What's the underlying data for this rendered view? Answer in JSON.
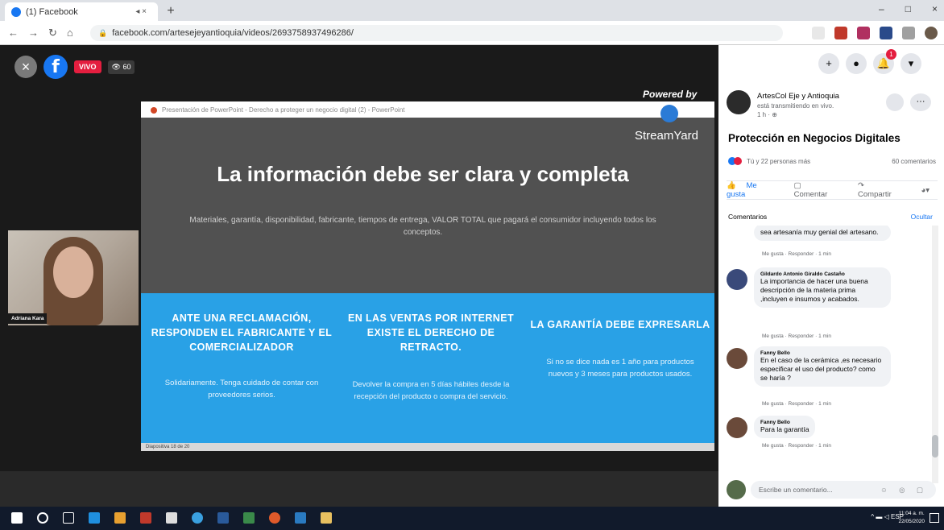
{
  "browser": {
    "tab_title": "(1) Facebook",
    "tab_audio": "◂ ×",
    "new_tab": "+",
    "url": "facebook.com/artesejeyantioquia/videos/2693758937496286/",
    "win_min": "–",
    "win_max": "□",
    "win_close": "×"
  },
  "video": {
    "live_label": "VIVO",
    "viewers": "60",
    "powered_by": "Powered by",
    "streamyard": "StreamYard",
    "presenter_name": "Adriana Kara"
  },
  "slide": {
    "window_bar": "Presentación de PowerPoint - Derecho a proteger un negocio digital (2) - PowerPoint",
    "title": "La información debe ser clara y completa",
    "subtitle": "Materiales, garantía, disponibilidad, fabricante, tiempos de entrega, VALOR TOTAL que pagará el consumidor incluyendo todos los conceptos.",
    "col1_title": "ANTE UNA RECLAMACIÓN, RESPONDEN EL FABRICANTE Y EL COMERCIALIZADOR",
    "col1_text": "Solidariamente. Tenga cuidado de contar con proveedores serios.",
    "col2_title": "EN LAS VENTAS POR INTERNET EXISTE EL DERECHO DE RETRACTO.",
    "col2_text": "Devolver la compra en 5 días hábiles desde la recepción del producto o compra del servicio.",
    "col3_title": "LA GARANTÍA DEBE EXPRESARLA",
    "col3_text": "Si no se dice nada es 1 año para productos nuevos y 3 meses para productos usados.",
    "status": "Diapositiva 18 de 20"
  },
  "panel": {
    "notif_count": "1",
    "author_name": "ArtesCol Eje y Antioquia",
    "author_status": "está transmitiendo en vivo.",
    "author_time": "1 h ·",
    "video_title": "Protección en Negocios Digitales",
    "reactions_text": "Tú y 22 personas más",
    "comments_count": "60 comentarios",
    "like_label": "Me gusta",
    "comment_label": "Comentar",
    "share_label": "Compartir",
    "comments_header": "Comentarios",
    "hide_label": "Ocultar",
    "comments": [
      {
        "name": "",
        "text": "sea artesanía muy genial del artesano.",
        "meta": "Me gusta · Responder · 1 min"
      },
      {
        "name": "Gildardo Antonio Giraldo Castaño",
        "text": "La importancia de hacer una buena descripción de la materia prima ,incluyen e insumos y acabados.",
        "meta": "Me gusta · Responder · 1 min"
      },
      {
        "name": "Fanny Bello",
        "text": "En el caso de la cerámica ,es necesario especificar el uso del producto? como se haría ?",
        "meta": "Me gusta · Responder · 1 min"
      },
      {
        "name": "Fanny Bello",
        "text": "Para la garantía",
        "meta": "Me gusta · Responder · 1 min"
      }
    ],
    "composer_placeholder": "Escribe un comentario...",
    "composer_icons": "☺ ◎ ▢"
  },
  "taskbar": {
    "tray_text": "^ ▬ ◁ ESP",
    "time": "11:04 a. m.",
    "date": "22/05/2020"
  }
}
